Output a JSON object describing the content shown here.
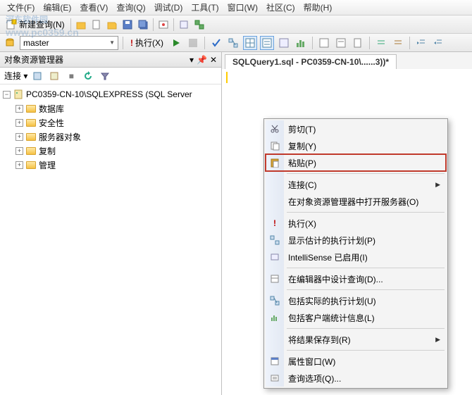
{
  "menubar": [
    "文件(F)",
    "编辑(E)",
    "查看(V)",
    "查询(Q)",
    "调试(D)",
    "工具(T)",
    "窗口(W)",
    "社区(C)",
    "帮助(H)"
  ],
  "toolbar1": {
    "new_query": "新建查询(N)"
  },
  "toolbar2": {
    "db_dropdown": "master",
    "execute": "执行(X)"
  },
  "left_panel": {
    "title": "对象资源管理器",
    "connect_label": "连接 ▾",
    "root": "PC0359-CN-10\\SQLEXPRESS (SQL Server",
    "children": [
      "数据库",
      "安全性",
      "服务器对象",
      "复制",
      "管理"
    ]
  },
  "editor": {
    "tab_title": "SQLQuery1.sql - PC0359-CN-10\\......3))*"
  },
  "watermark": {
    "main": "河东软件园",
    "sub": "www.pc0359.cn"
  },
  "context_menu": [
    {
      "icon": "cut",
      "label": "剪切(T)"
    },
    {
      "icon": "copy",
      "label": "复制(Y)"
    },
    {
      "icon": "paste",
      "label": "粘贴(P)",
      "highlight": true
    },
    {
      "sep": true
    },
    {
      "icon": "",
      "label": "连接(C)",
      "sub": true
    },
    {
      "icon": "",
      "label": "在对象资源管理器中打开服务器(O)"
    },
    {
      "sep": true
    },
    {
      "icon": "exec",
      "label": "执行(X)"
    },
    {
      "icon": "plan",
      "label": "显示估计的执行计划(P)"
    },
    {
      "icon": "intel",
      "label": "IntelliSense 已启用(I)"
    },
    {
      "sep": true
    },
    {
      "icon": "design",
      "label": "在编辑器中设计查询(D)..."
    },
    {
      "sep": true
    },
    {
      "icon": "incplan",
      "label": "包括实际的执行计划(U)"
    },
    {
      "icon": "stats",
      "label": "包括客户端统计信息(L)"
    },
    {
      "sep": true
    },
    {
      "icon": "",
      "label": "将结果保存到(R)",
      "sub": true
    },
    {
      "sep": true
    },
    {
      "icon": "prop",
      "label": "属性窗口(W)"
    },
    {
      "icon": "opt",
      "label": "查询选项(Q)..."
    }
  ]
}
